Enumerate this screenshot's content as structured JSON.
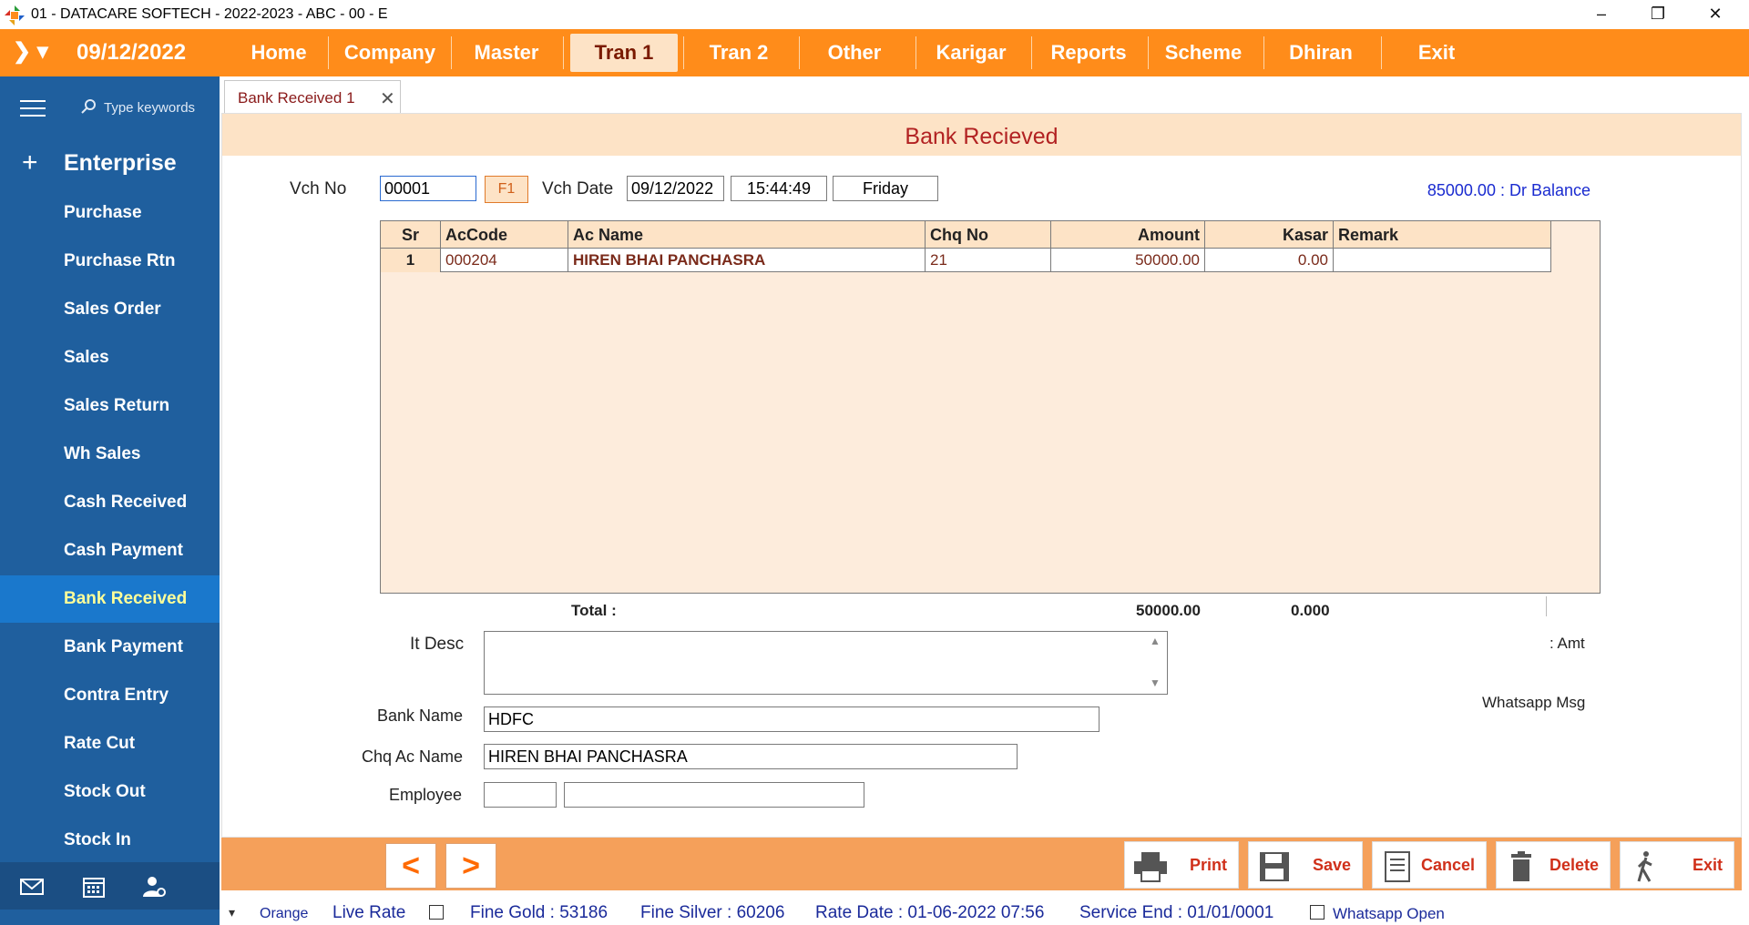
{
  "window": {
    "title": "01 - DATACARE SOFTECH - 2022-2023 - ABC - 00 - E",
    "logo_icon": "datacare-logo",
    "controls": {
      "minimize": "–",
      "restore": "❐",
      "close": "✕"
    }
  },
  "menubar": {
    "toggle": "❯ ▾",
    "date": "09/12/2022",
    "items": [
      {
        "label": "Home"
      },
      {
        "label": "Company"
      },
      {
        "label": "Master"
      },
      {
        "label": "Tran 1",
        "active": true
      },
      {
        "label": "Tran 2"
      },
      {
        "label": "Other"
      },
      {
        "label": "Karigar"
      },
      {
        "label": "Reports"
      },
      {
        "label": "Scheme"
      },
      {
        "label": "Dhiran"
      },
      {
        "label": "Exit"
      }
    ]
  },
  "sidebar": {
    "search_placeholder": "Type keywords",
    "group_icon": "+",
    "group_label": "Enterprise",
    "items": [
      {
        "label": "Purchase"
      },
      {
        "label": "Purchase Rtn"
      },
      {
        "label": "Sales Order"
      },
      {
        "label": "Sales"
      },
      {
        "label": "Sales Return"
      },
      {
        "label": "Wh Sales"
      },
      {
        "label": "Cash Received"
      },
      {
        "label": "Cash Payment"
      },
      {
        "label": "Bank Received",
        "active": true
      },
      {
        "label": "Bank Payment"
      },
      {
        "label": "Contra Entry"
      },
      {
        "label": "Rate Cut"
      },
      {
        "label": "Stock Out"
      },
      {
        "label": "Stock In"
      }
    ],
    "bottom_icons": [
      "mail-icon",
      "calendar-icon",
      "user-settings-icon"
    ]
  },
  "tab": {
    "label": "Bank Received 1",
    "close": "✕"
  },
  "form": {
    "title": "Bank Recieved",
    "vch_no_label": "Vch No",
    "vch_no_value": "00001",
    "f1_label": "F1",
    "vch_date_label": "Vch Date",
    "vch_date_value": "09/12/2022",
    "time_value": "15:44:49",
    "day_value": "Friday",
    "balance": "85000.00 : Dr Balance",
    "grid": {
      "columns": [
        "Sr",
        "AcCode",
        "Ac Name",
        "Chq No",
        "Amount",
        "Kasar",
        "Remark"
      ],
      "rows": [
        {
          "sr": "1",
          "accode": "000204",
          "acname": "HIREN BHAI PANCHASRA",
          "chqno": "21",
          "amount": "50000.00",
          "kasar": "0.00",
          "remark": ""
        }
      ]
    },
    "total_label": "Total :",
    "total_amount": "50000.00",
    "total_kasar": "0.000",
    "it_desc_label": "It Desc",
    "it_desc_value": "",
    "amt_label": ": Amt",
    "whatsapp_msg_label": "Whatsapp Msg",
    "bank_name_label": "Bank Name",
    "bank_name_value": "HDFC",
    "chq_ac_name_label": "Chq Ac Name",
    "chq_ac_name_value": "HIREN BHAI PANCHASRA",
    "employee_label": "Employee",
    "employee_code": "",
    "employee_name": ""
  },
  "actions": {
    "prev": "<",
    "next": ">",
    "print": "Print",
    "save": "Save",
    "cancel": "Cancel",
    "delete": "Delete",
    "exit": "Exit"
  },
  "statusbar": {
    "dropdown": "▾",
    "theme": "Orange",
    "live_rate": "Live Rate",
    "fine_gold": "Fine Gold : 53186",
    "fine_silver": "Fine Silver : 60206",
    "rate_date": "Rate Date : 01-06-2022 07:56",
    "service_end": "Service End :  01/01/0001",
    "whatsapp_open": "Whatsapp Open"
  },
  "colors": {
    "menubar": "#ff8c1a",
    "sidebar": "#1f5f9e",
    "sidebar_active": "#1a78cc",
    "header_band": "#fde3c6",
    "grid_bg": "#fdecdc",
    "action_bar": "#f5a05a",
    "title_red": "#b22222",
    "link_blue": "#1a2bd0"
  }
}
